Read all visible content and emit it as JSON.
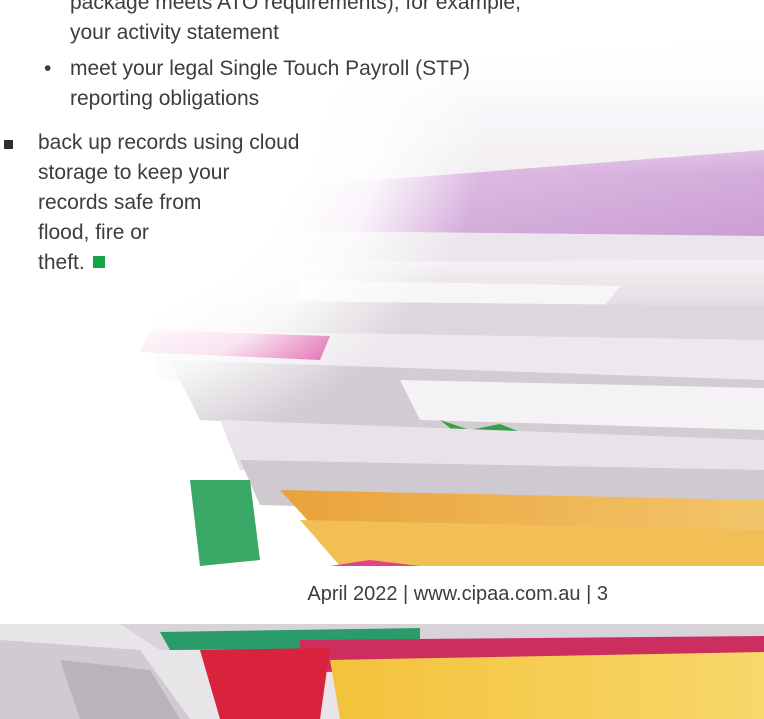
{
  "sub_bullets": [
    {
      "marker": "",
      "text": "package meets ATO requirements), for example,\nyour activity statement"
    },
    {
      "marker": "•",
      "text": "meet your legal Single Touch Payroll (STP)\nreporting obligations"
    }
  ],
  "main_bullet": {
    "text": "back up records using cloud\nstorage to keep your\nrecords safe from\nflood, fire or\ntheft."
  },
  "footer": {
    "date": "April 2022",
    "separator": "|",
    "url": "www.cipaa.com.au",
    "page_number": "3"
  },
  "colors": {
    "end_mark": "#16a34a",
    "body_text": "#3d3d3d"
  }
}
